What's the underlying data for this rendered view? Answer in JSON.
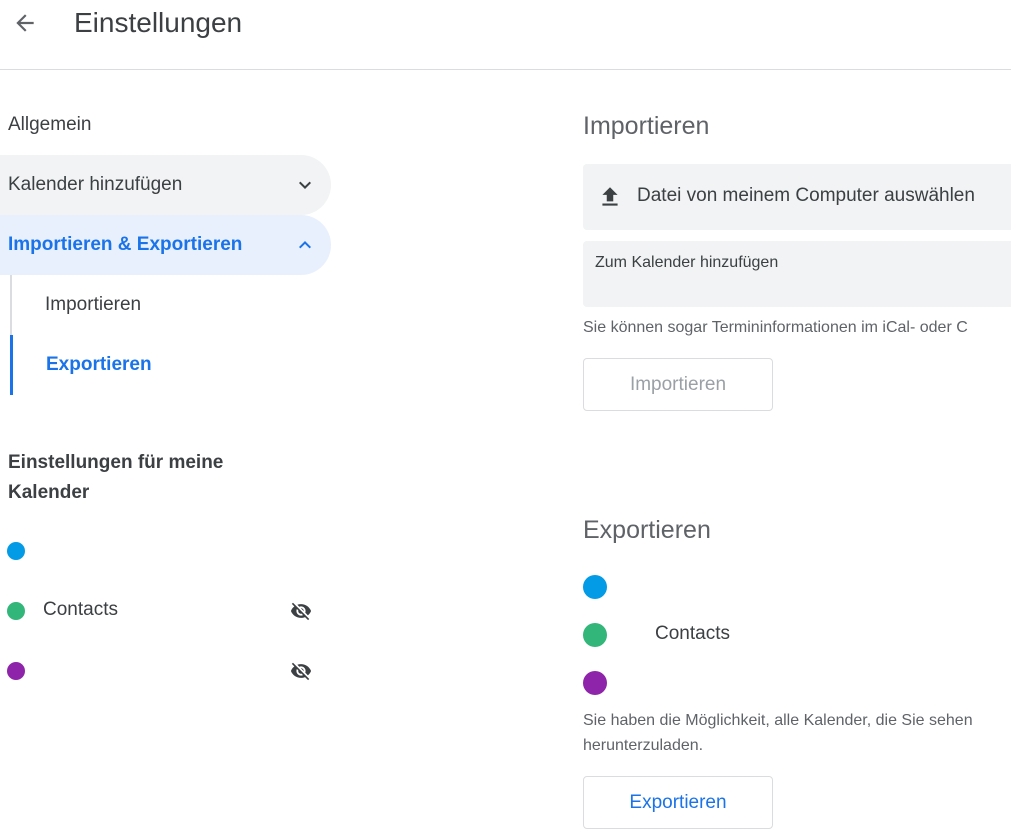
{
  "header": {
    "title": "Einstellungen",
    "back_icon": "arrow-back-icon"
  },
  "sidebar": {
    "general": "Allgemein",
    "add_calendar": "Kalender hinzufügen",
    "import_export": "Importieren & Exportieren",
    "sub_import": "Importieren",
    "sub_export": "Exportieren",
    "my_calendars_heading": "Einstellungen für meine Kalender",
    "calendars": [
      {
        "name": "",
        "color": "#039be5",
        "hidden": false
      },
      {
        "name": "Contacts",
        "color": "#33b679",
        "hidden": true
      },
      {
        "name": "",
        "color": "#8e24aa",
        "hidden": true
      }
    ]
  },
  "import": {
    "heading": "Importieren",
    "file_picker_label": "Datei von meinem Computer auswählen",
    "add_to_calendar_label": "Zum Kalender hinzufügen",
    "help_text": "Sie können sogar Termininformationen im iCal- oder C",
    "button_label": "Importieren"
  },
  "export": {
    "heading": "Exportieren",
    "calendars": [
      {
        "name": "",
        "color": "#039be5"
      },
      {
        "name": "Contacts",
        "color": "#33b679"
      },
      {
        "name": "",
        "color": "#8e24aa"
      }
    ],
    "help_text_line1": "Sie haben die Möglichkeit, alle Kalender, die Sie sehen",
    "help_text_line2": "herunterzuladen.",
    "button_label": "Exportieren"
  },
  "colors": {
    "accent": "#1a73e8",
    "active_bg": "#e8f0fe",
    "gray_bg": "#f1f3f4"
  }
}
